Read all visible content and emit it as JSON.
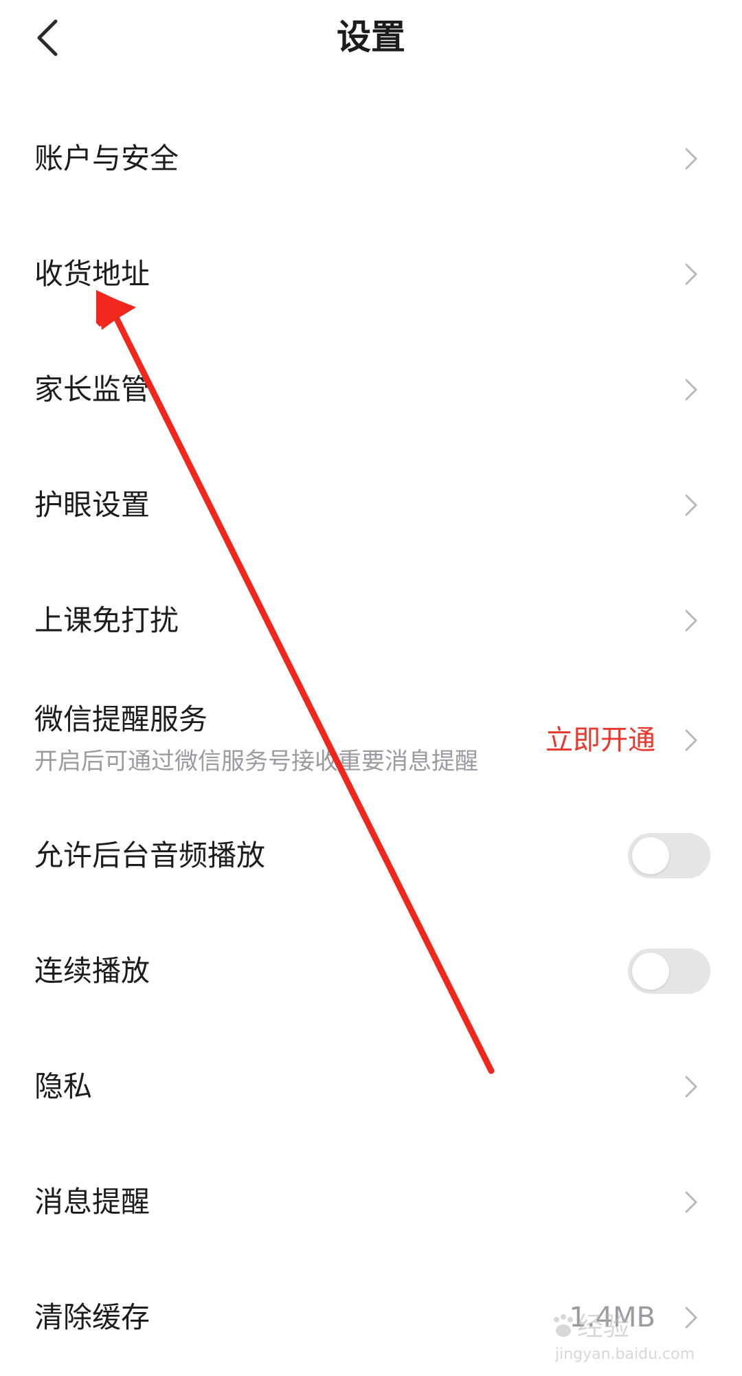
{
  "header": {
    "title": "设置",
    "back_icon": "chevron-left-icon"
  },
  "settings": {
    "account_security": {
      "label": "账户与安全"
    },
    "shipping_address": {
      "label": "收货地址"
    },
    "parental_control": {
      "label": "家长监管"
    },
    "eye_care": {
      "label": "护眼设置"
    },
    "class_dnd": {
      "label": "上课免打扰"
    },
    "wechat_reminder": {
      "label": "微信提醒服务",
      "description": "开启后可通过微信服务号接收重要消息提醒",
      "action": "立即开通"
    },
    "background_audio": {
      "label": "允许后台音频播放",
      "enabled": false
    },
    "continuous_play": {
      "label": "连续播放",
      "enabled": false
    },
    "privacy": {
      "label": "隐私"
    },
    "message_reminder": {
      "label": "消息提醒"
    },
    "clear_cache": {
      "label": "清除缓存",
      "value": "1.4MB"
    }
  },
  "watermark": {
    "brand": "经验",
    "url": "jingyan.baidu.com"
  },
  "colors": {
    "text": "#1c1c1e",
    "secondary_text": "#9a9aa0",
    "action_red": "#e8392f",
    "annotation_arrow": "#f0271c",
    "toggle_off": "#e5e5e8",
    "chevron": "#b8b8bc"
  }
}
